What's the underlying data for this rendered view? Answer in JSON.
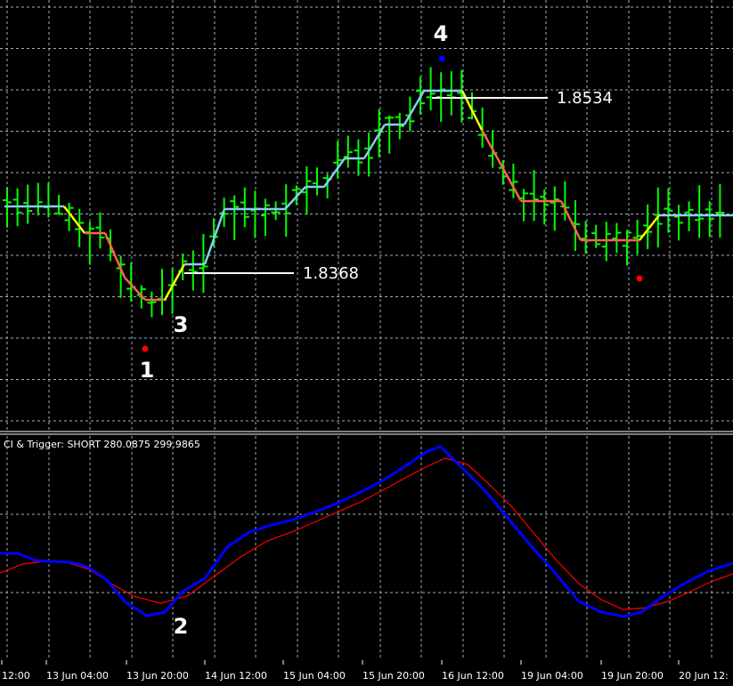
{
  "chart_data": [
    {
      "type": "ohlc",
      "title": "",
      "x_tick_labels": [
        "12:00",
        "13 Jun 04:00",
        "13 Jun 20:00",
        "14 Jun 12:00",
        "15 Jun 04:00",
        "15 Jun 20:00",
        "16 Jun 12:00",
        "19 Jun 04:00",
        "19 Jun 20:00",
        "20 Jun 12:"
      ],
      "price_levels": [
        {
          "label": "1.8368",
          "value": 1.8368
        },
        {
          "label": "1.8534",
          "value": 1.8534
        }
      ],
      "wave_labels": [
        {
          "label": "1",
          "bar": 13
        },
        {
          "label": "3",
          "bar": 17
        },
        {
          "label": "4",
          "bar": 42
        }
      ],
      "signal_dots": [
        {
          "bar": 13,
          "color": "#ff0000"
        },
        {
          "bar": 42,
          "color": "#0000ff"
        },
        {
          "bar": 61,
          "color": "#ff0000"
        }
      ],
      "bar_color": "#00ff00",
      "stepped_line_colors": {
        "rising": "#87ceeb",
        "falling": "#ff6347",
        "flat": "#ff6347",
        "transition": "#ffff00"
      }
    },
    {
      "type": "line",
      "title": "CI & Trigger: SHORT 280.0875 299.9865",
      "series": [
        {
          "name": "CI",
          "color": "#0000ff"
        },
        {
          "name": "Trigger",
          "color": "#ff0000"
        }
      ],
      "wave_labels": [
        {
          "label": "2",
          "bar": 17
        }
      ]
    }
  ],
  "colors": {
    "background": "#000000",
    "grid": "#a0aeb4",
    "separator": "#ffffff"
  }
}
